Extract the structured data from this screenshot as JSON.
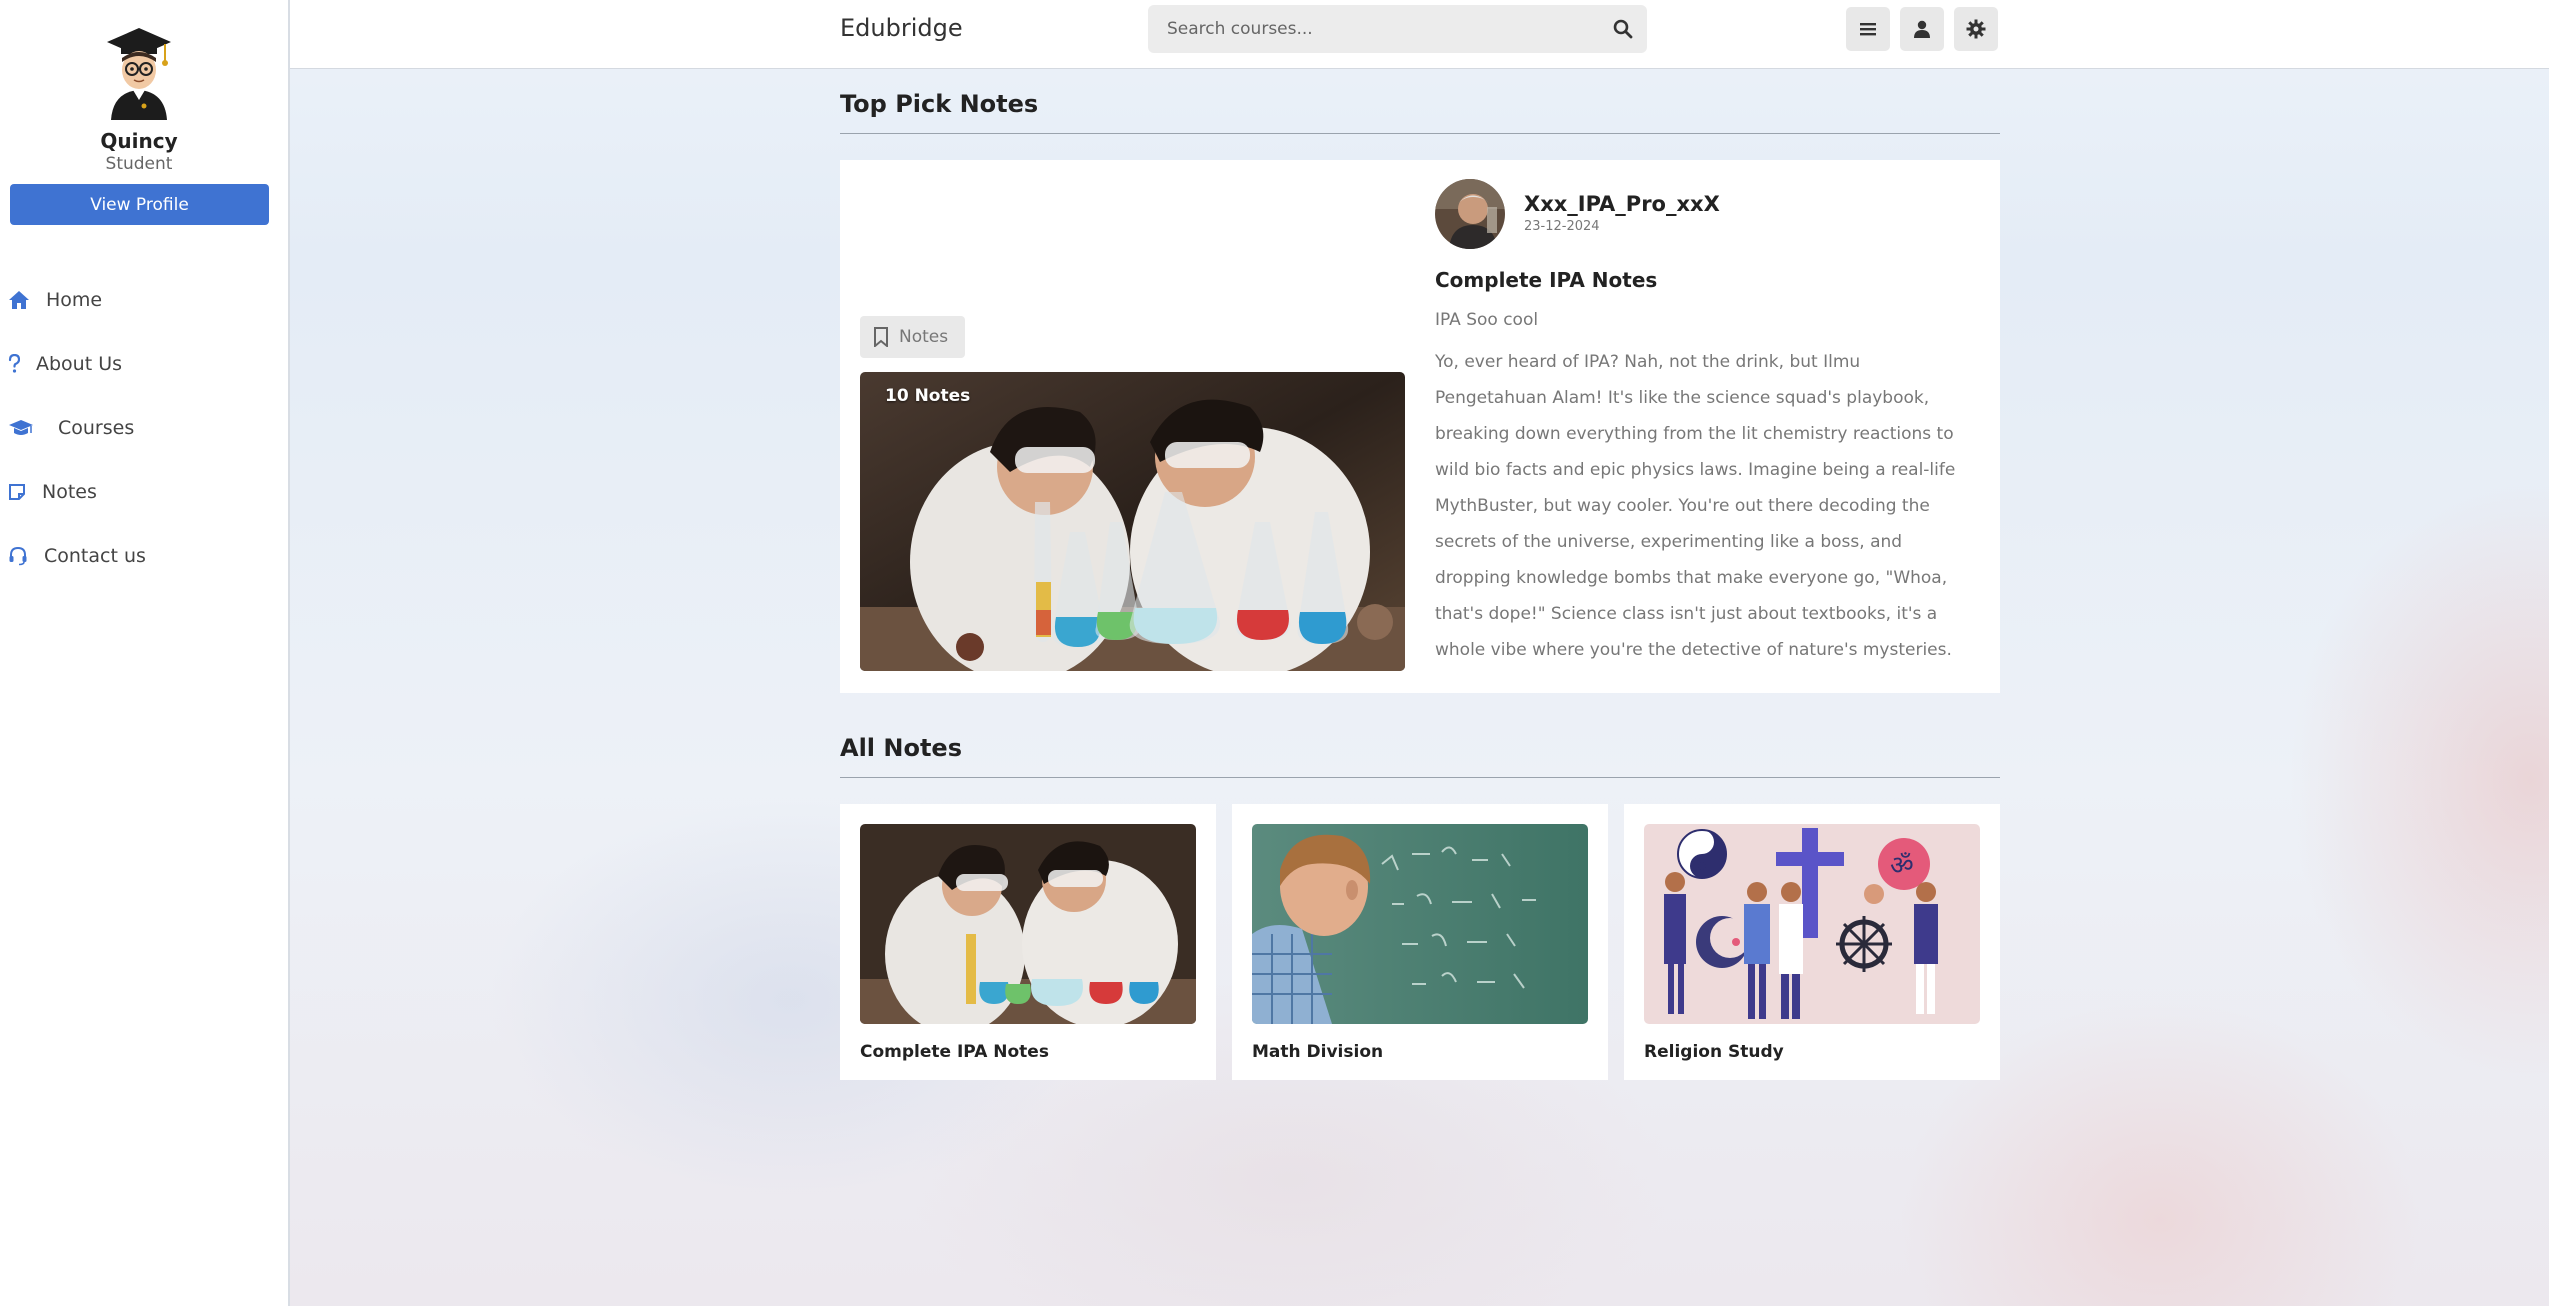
{
  "app": {
    "brand": "Edubridge"
  },
  "user": {
    "name": "Quincy",
    "role": "Student",
    "view_profile_label": "View Profile"
  },
  "nav": {
    "items": [
      {
        "label": "Home",
        "icon": "home-icon"
      },
      {
        "label": "About Us",
        "icon": "question-icon"
      },
      {
        "label": "Courses",
        "icon": "graduation-cap-icon"
      },
      {
        "label": "Notes",
        "icon": "note-icon"
      },
      {
        "label": "Contact us",
        "icon": "headset-icon"
      }
    ]
  },
  "search": {
    "placeholder": "Search courses...",
    "value": ""
  },
  "topbar_icons": [
    "menu-icon",
    "user-icon",
    "settings-icon"
  ],
  "colors": {
    "accent": "#3f73d2",
    "sidebar_bg": "#ffffff",
    "card_bg": "#ffffff"
  },
  "top_pick": {
    "section_title": "Top Pick Notes",
    "tag": "Notes",
    "badge": "10 Notes",
    "author": "Xxx_IPA_Pro_xxX",
    "date": "23-12-2024",
    "title": "Complete IPA Notes",
    "subtitle": "IPA Soo cool",
    "description": "Yo, ever heard of IPA? Nah, not the drink, but Ilmu Pengetahuan Alam! It's like the science squad's playbook, breaking down everything from the lit chemistry reactions to wild bio facts and epic physics laws. Imagine being a real-life MythBuster, but way cooler. You're out there decoding the secrets of the universe, experimenting like a boss, and dropping knowledge bombs that make everyone go, \"Whoa, that's dope!\" Science class isn't just about textbooks, it's a whole vibe where you're the detective of nature's mysteries."
  },
  "all_notes": {
    "section_title": "All Notes",
    "items": [
      {
        "title": "Complete IPA Notes"
      },
      {
        "title": "Math Division"
      },
      {
        "title": "Religion Study"
      }
    ]
  }
}
